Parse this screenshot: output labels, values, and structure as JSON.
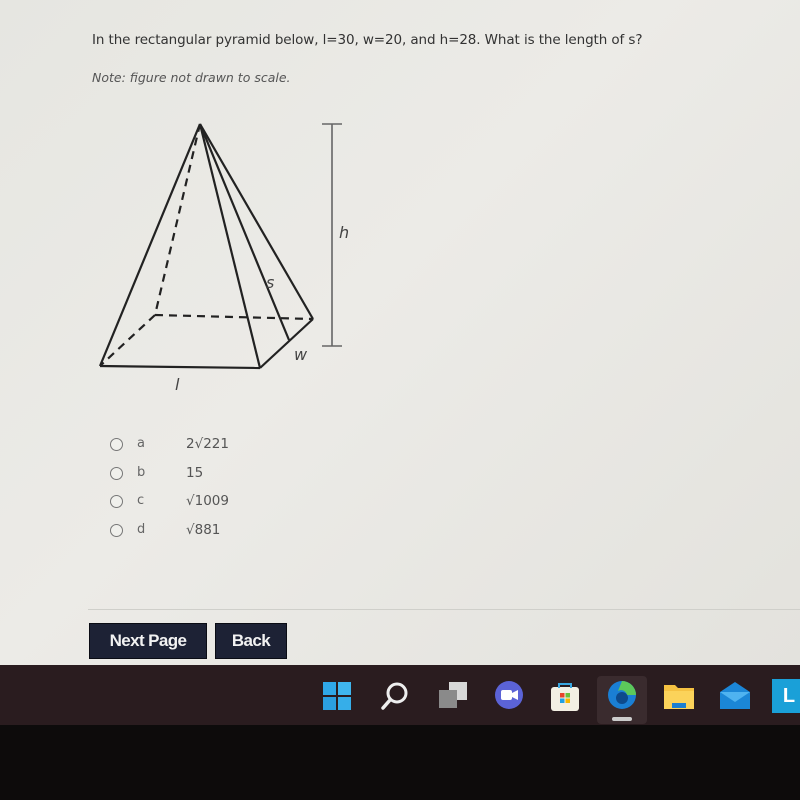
{
  "question": {
    "text": "In the rectangular pyramid below, l=30, w=20, and h=28. What is the length of s?",
    "note": "Note: figure not drawn to scale."
  },
  "figure": {
    "labels": {
      "height": "h",
      "slant": "s",
      "width": "w",
      "length": "l"
    }
  },
  "choices": [
    {
      "letter": "a",
      "value": "2√221"
    },
    {
      "letter": "b",
      "value": "15"
    },
    {
      "letter": "c",
      "value": "√1009"
    },
    {
      "letter": "d",
      "value": "√881"
    }
  ],
  "buttons": {
    "next": "Next Page",
    "back": "Back"
  },
  "taskbar": {
    "icons": [
      "start-icon",
      "search-icon",
      "task-view-icon",
      "teams-chat-icon",
      "store-icon",
      "edge-icon",
      "file-explorer-icon",
      "mail-icon",
      "app-icon"
    ],
    "active": "edge-icon",
    "partial_label": "L"
  }
}
